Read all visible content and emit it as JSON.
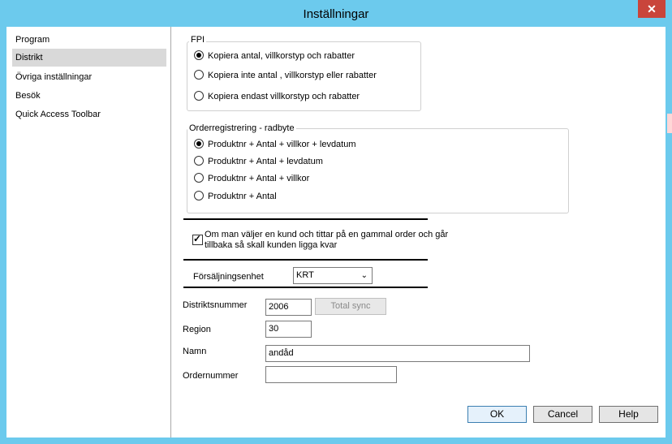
{
  "window": {
    "title": "Inställningar",
    "close_glyph": "✕"
  },
  "sidebar": {
    "items": [
      {
        "label": "Program"
      },
      {
        "label": "Distrikt"
      },
      {
        "label": "Övriga inställningar"
      },
      {
        "label": "Besök"
      },
      {
        "label": "Quick Access Toolbar"
      }
    ],
    "selected": "Distrikt"
  },
  "fpi": {
    "title": "FPI",
    "options": [
      {
        "label": "Kopiera antal, villkorstyp och rabatter",
        "selected": true
      },
      {
        "label": "Kopiera inte antal , villkorstyp eller rabatter",
        "selected": false
      },
      {
        "label": "Kopiera endast villkorstyp och rabatter",
        "selected": false
      }
    ]
  },
  "order_reg": {
    "title": "Orderregistrering - radbyte",
    "options": [
      {
        "label": "Produktnr + Antal + villkor + levdatum",
        "selected": true
      },
      {
        "label": "Produktnr + Antal + levdatum",
        "selected": false
      },
      {
        "label": "Produktnr + Antal + villkor",
        "selected": false
      },
      {
        "label": "Produktnr + Antal",
        "selected": false
      }
    ]
  },
  "keep_customer": {
    "line1": "Om man väljer en kund och tittar på en gammal order och går",
    "line2": "tillbaka så skall kunden ligga kvar",
    "checked": true
  },
  "sales_unit": {
    "label": "Försäljningsenhet",
    "value": "KRT"
  },
  "fields": {
    "district_number_label": "Distriktsnummer",
    "district_number_value": "2006",
    "total_sync_label": "Total sync",
    "region_label": "Region",
    "region_value": "30",
    "name_label": "Namn",
    "name_value": "andåd",
    "order_number_label": "Ordernummer",
    "order_number_value": ""
  },
  "buttons": {
    "ok": "OK",
    "cancel": "Cancel",
    "help": "Help"
  },
  "colors": {
    "frame": "#6ccaed",
    "close": "#c9453b",
    "selection": "#d9d9d9"
  }
}
